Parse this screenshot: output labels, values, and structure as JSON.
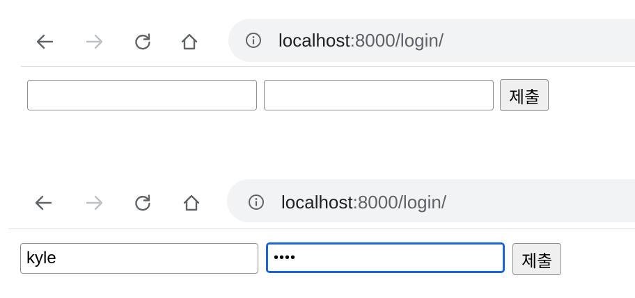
{
  "colors": {
    "omnibox_bg": "#f1f3f4",
    "focus_ring": "#1a64d9",
    "url_path": "#5f6368"
  },
  "icons": {
    "back": "back-arrow-icon",
    "forward": "forward-arrow-icon",
    "reload": "reload-icon",
    "home": "home-icon",
    "info": "info-icon"
  },
  "screens": [
    {
      "url_host": "localhost",
      "url_path": ":8000/login/",
      "username_value": "",
      "password_value": "",
      "submit_label": "제출"
    },
    {
      "url_host": "localhost",
      "url_path": ":8000/login/",
      "username_value": "kyle",
      "password_value": "••••",
      "password_focused": true,
      "submit_label": "제출"
    }
  ]
}
